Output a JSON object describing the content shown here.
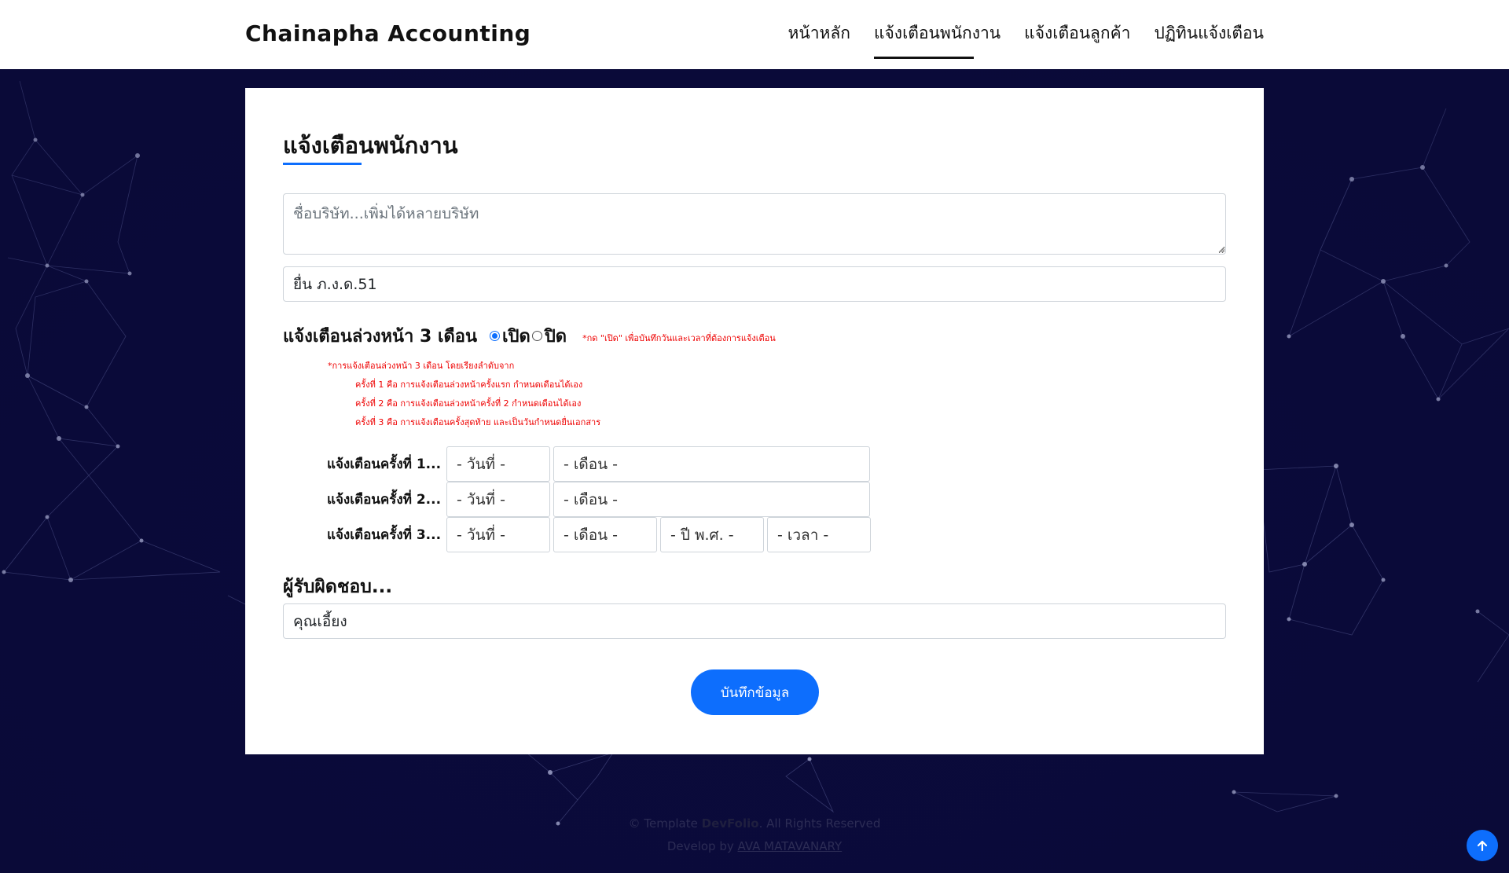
{
  "header": {
    "brand": "Chainapha Accounting",
    "nav": [
      "หน้าหลัก",
      "แจ้งเตือนพนักงาน",
      "แจ้งเตือนลูกค้า",
      "ปฏิทินแจ้งเตือน"
    ],
    "active_index": 1
  },
  "form": {
    "title": "แจ้งเตือนพนักงาน",
    "company_placeholder": "ชื่อบริษัท...เพิ่มได้หลายบริษัท",
    "task_value": "ยื่น ภ.ง.ด.51",
    "advance_label": "แจ้งเตือนล่วงหน้า 3 เดือน",
    "radio_on": "เปิด",
    "radio_off": "ปิด",
    "radio_selected": "เปิด",
    "advance_hint": "*กด \"เปิด\" เพื่อบันทึกวันและเวลาที่ต้องการแจ้งเตือน",
    "notes": [
      "*การแจ้งเตือนล่วงหน้า 3 เดือน โดยเรียงลำดับจาก",
      "ครั้งที่ 1 คือ การแจ้งเตือนล่วงหน้าครั้งแรก กำหนดเดือนได้เอง",
      "ครั้งที่ 2 คือ การแจ้งเตือนล่วงหน้าครั้งที่ 2 กำหนดเดือนได้เอง",
      "ครั้งที่ 3 คือ การแจ้งเตือนครั้งสุดท้าย และเป็นวันกำหนดยื่นเอกสาร"
    ],
    "alerts": [
      {
        "label": "แจ้งเตือนครั้งที่ 1...",
        "day": "- วันที่ -",
        "month": "- เดือน -"
      },
      {
        "label": "แจ้งเตือนครั้งที่ 2...",
        "day": "- วันที่ -",
        "month": "- เดือน -"
      },
      {
        "label": "แจ้งเตือนครั้งที่ 3...",
        "day": "- วันที่ -",
        "month": "- เดือน -",
        "year": "- ปี พ.ศ. -",
        "time": "- เวลา -"
      }
    ],
    "owner_label": "ผู้รับผิดชอบ...",
    "owner_value": "คุณเอี้ยง",
    "save_label": "บันทึกข้อมูล"
  },
  "footer": {
    "copy_prefix": "© Template",
    "copy_brand": "DevFolio",
    "copy_suffix": ". All Rights Reserved",
    "dev_prefix": "Develop by",
    "dev_name": "AVA MATAVANARY"
  },
  "colors": {
    "accent": "#0d6efd",
    "background": "#0b0b3b",
    "note_red": "#e00000"
  },
  "icons": {
    "back_to_top": "arrow-up-icon"
  }
}
